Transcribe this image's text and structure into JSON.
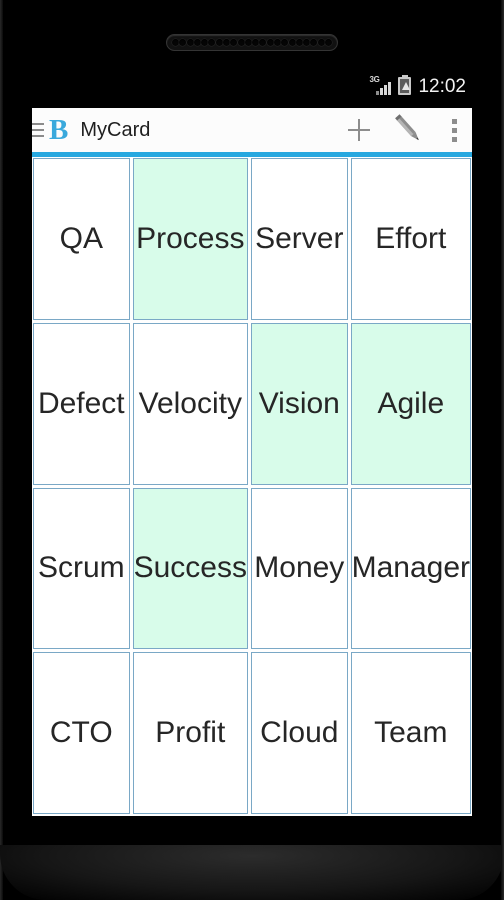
{
  "device": {
    "earpiece_holes": 22
  },
  "status_bar": {
    "network_label": "3G",
    "signal_icon": "signal-bars-icon",
    "battery_icon": "battery-charging-icon",
    "clock": "12:02"
  },
  "app_bar": {
    "drawer_icon": "hamburger-menu-icon",
    "logo_letter": "B",
    "title": "MyCard",
    "add_icon": "plus-icon",
    "edit_icon": "pencil-icon",
    "overflow_icon": "three-dot-overflow-icon"
  },
  "colors": {
    "accent_blue": "#27a8e0",
    "logo_blue": "#3aa9dc",
    "card_border": "#7aa8c6",
    "card_selected_bg": "#d8fcea",
    "card_bg": "#ffffff",
    "card_text": "#262626",
    "status_bar_bg": "#000000",
    "app_bar_bg": "#fcfcfc"
  },
  "grid": {
    "columns": 4,
    "rows": 4,
    "cards": [
      {
        "label": "QA",
        "selected": false
      },
      {
        "label": "Process",
        "selected": true
      },
      {
        "label": "Server",
        "selected": false
      },
      {
        "label": "Effort",
        "selected": false
      },
      {
        "label": "Defect",
        "selected": false
      },
      {
        "label": "Velocity",
        "selected": false
      },
      {
        "label": "Vision",
        "selected": true
      },
      {
        "label": "Agile",
        "selected": true
      },
      {
        "label": "Scrum",
        "selected": false
      },
      {
        "label": "Success",
        "selected": true
      },
      {
        "label": "Money",
        "selected": false
      },
      {
        "label": "Manager",
        "selected": false
      },
      {
        "label": "CTO",
        "selected": false
      },
      {
        "label": "Profit",
        "selected": false
      },
      {
        "label": "Cloud",
        "selected": false
      },
      {
        "label": "Team",
        "selected": false
      }
    ]
  }
}
